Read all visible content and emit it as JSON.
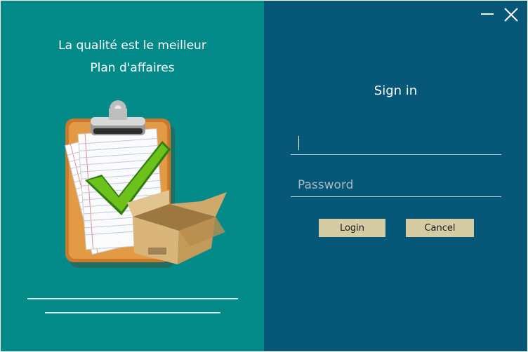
{
  "branding": {
    "tagline_line1": "La qualité est le meilleur",
    "tagline_line2": "Plan d'affaires",
    "illustration": "clipboard-checkmark-box-icon"
  },
  "window_controls": {
    "minimize_icon": "minimize-icon",
    "close_icon": "close-icon"
  },
  "signin": {
    "title": "Sign in",
    "username_value": "",
    "username_placeholder": "",
    "password_value": "",
    "password_placeholder": "Password",
    "login_label": "Login",
    "cancel_label": "Cancel"
  },
  "colors": {
    "left_panel": "#058a8a",
    "right_panel": "#075878",
    "button": "#d5cca4"
  }
}
